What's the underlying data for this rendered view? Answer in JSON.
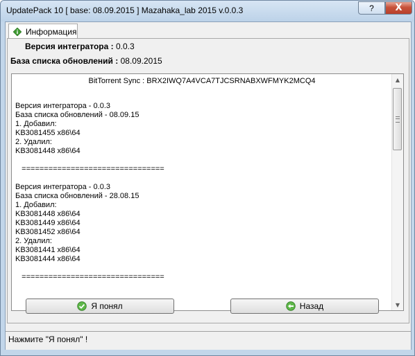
{
  "window": {
    "title": "UpdatePack 10 [ base: 08.09.2015 ] Mazahaka_lab 2015 v.0.0.3",
    "help_label": "?",
    "close_label": "X"
  },
  "tab": {
    "label": "Информация",
    "icon": "info-diamond-icon"
  },
  "info": {
    "integrator_label": "Версия интегратора :",
    "integrator_value": "0.0.3",
    "base_label": "База списка обновлений :",
    "base_value": "08.09.2015"
  },
  "textbox": {
    "sync_line": "BitTorrent Sync :  BRX2IWQ7A4VCA7TJCSRNABXWFMYK2MCQ4",
    "log_text": "Версия интегратора - 0.0.3\nБаза списка обновлений - 08.09.15\n1. Добавил:\nKB3081455 x86\\64\n2. Удалил:\nKB3081448 x86\\64\n\n   ================================\n\nВерсия интегратора - 0.0.3\nБаза списка обновлений - 28.08.15\n1. Добавил:\nKB3081448 x86\\64\nKB3081449 x86\\64\nKB3081452 x86\\64\n2. Удалил:\nKB3081441 x86\\64\nKB3081444 x86\\64\n\n   ================================"
  },
  "buttons": {
    "ok_label": "Я понял",
    "back_label": "Назад"
  },
  "status": {
    "text": "Нажмите \"Я понял\" !"
  },
  "colors": {
    "titlebar": "#c2d6ea",
    "close_button": "#c7513a",
    "ok_icon": "#3a9a2a",
    "back_icon": "#3a9a2a"
  }
}
